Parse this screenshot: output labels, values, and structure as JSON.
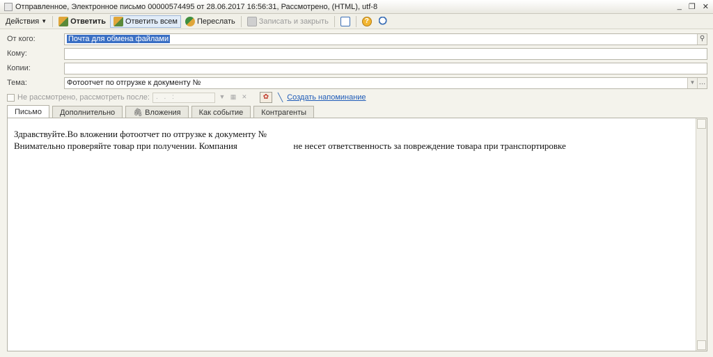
{
  "window": {
    "title": "Отправленное, Электронное письмо 00000574495 от 28.06.2017 16:56:31, Рассмотрено,  (HTML), utf-8",
    "controls": [
      "_",
      "❐",
      "✕"
    ]
  },
  "toolbar": {
    "actions": "Действия",
    "reply": "Ответить",
    "reply_all": "Ответить всем",
    "forward": "Переслать",
    "save_close": "Записать и закрыть"
  },
  "form": {
    "from_label": "От кого:",
    "from_value": "Почта для обмена файлами",
    "to_label": "Кому:",
    "to_value": "",
    "cc_label": "Копии:",
    "cc_value": "",
    "subject_label": "Тема:",
    "subject_value": "Фотоотчет по отгрузке к документу №",
    "review_label": "Не рассмотрено, рассмотреть после:",
    "review_date": ". .   :",
    "reminder_link": "Создать напоминание"
  },
  "tabs": [
    {
      "label": "Письмо"
    },
    {
      "label": "Дополнительно"
    },
    {
      "label": "Вложения"
    },
    {
      "label": "Как событие"
    },
    {
      "label": "Контрагенты"
    }
  ],
  "letter": {
    "line1": "Здравствуйте.Во вложении фотоотчет по отгрузке к документу №",
    "line2a": "Внимательно проверяйте товар при получении. Компания",
    "line2b": "не несет ответственность за повреждение товара при транспортировке"
  }
}
